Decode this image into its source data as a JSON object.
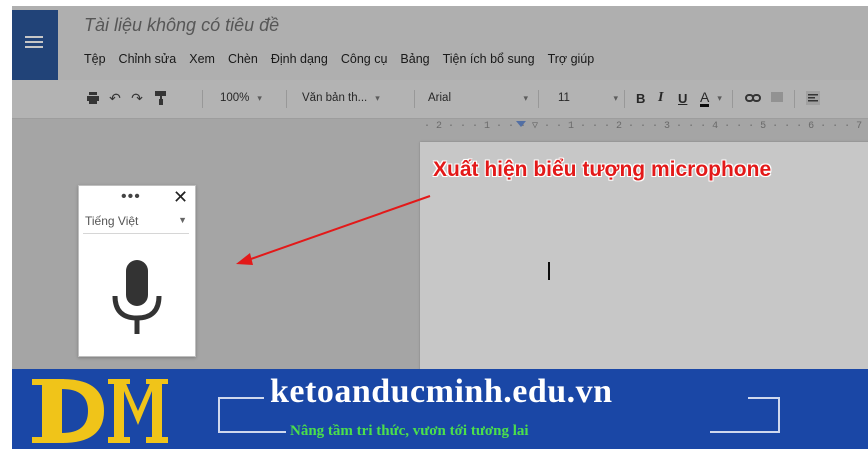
{
  "document": {
    "title": "Tài liệu không có tiêu đề"
  },
  "menu": [
    "Tệp",
    "Chỉnh sửa",
    "Xem",
    "Chèn",
    "Định dạng",
    "Công cụ",
    "Bảng",
    "Tiện ích bổ sung",
    "Trợ giúp"
  ],
  "toolbar": {
    "zoom": "100%",
    "style": "Văn bản th...",
    "font": "Arial",
    "size": "11",
    "bold": "B",
    "italic": "I",
    "underline": "U",
    "text_color": "A"
  },
  "ruler": "· 2 · · · 1 · · · ▽ · · 1 · · · 2 · · · 3 · · · 4 · · · 5 · · · 6 · · · 7 · ·",
  "voice_typing": {
    "more": "•••",
    "close": "✕",
    "language": "Tiếng Việt"
  },
  "annotation": "Xuất hiện biểu tượng microphone",
  "banner": {
    "site": "ketoanducminh.edu.vn",
    "tagline": "Nâng tầm tri thức, vươn tới tương lai"
  },
  "colors": {
    "docs_blue": "#2b579a",
    "annotation_red": "#e31919",
    "banner_blue": "#1a47a6",
    "tagline_green": "#4be04b",
    "logo_gold": "#f0c419"
  }
}
